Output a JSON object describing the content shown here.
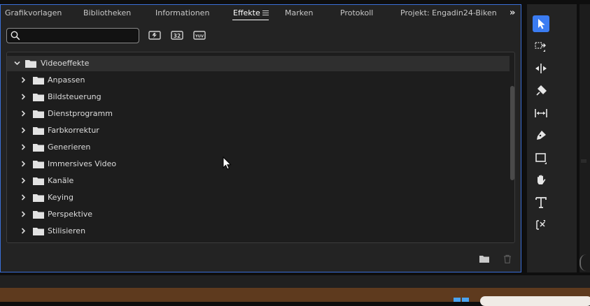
{
  "tabs": [
    {
      "label": "Grafikvorlagen"
    },
    {
      "label": "Bibliotheken"
    },
    {
      "label": "Informationen"
    },
    {
      "label": "Effekte"
    },
    {
      "label": "Marken"
    },
    {
      "label": "Protokoll"
    },
    {
      "label": "Projekt: Engadin24-Biken"
    }
  ],
  "active_tab": "Effekte",
  "search": {
    "value": "",
    "placeholder": ""
  },
  "filter_buttons": [
    {
      "icon": "accelerated-effects-icon"
    },
    {
      "icon": "32bit-effects-icon",
      "text": "32"
    },
    {
      "icon": "yuv-effects-icon",
      "text": "YUV"
    }
  ],
  "tree": {
    "root": {
      "label": "Videoeffekte",
      "expanded": true
    },
    "items": [
      {
        "label": "Anpassen"
      },
      {
        "label": "Bildsteuerung"
      },
      {
        "label": "Dienstprogramm"
      },
      {
        "label": "Farbkorrektur"
      },
      {
        "label": "Generieren"
      },
      {
        "label": "Immersives Video"
      },
      {
        "label": "Kanäle"
      },
      {
        "label": "Keying"
      },
      {
        "label": "Perspektive"
      },
      {
        "label": "Stilisieren"
      }
    ]
  },
  "tools": [
    {
      "icon": "selection-tool-icon",
      "selected": true
    },
    {
      "icon": "track-select-forward-icon"
    },
    {
      "icon": "ripple-edit-icon"
    },
    {
      "icon": "razor-icon"
    },
    {
      "icon": "slip-icon"
    },
    {
      "icon": "pen-icon"
    },
    {
      "icon": "rectangle-icon"
    },
    {
      "icon": "hand-icon"
    },
    {
      "icon": "type-icon"
    },
    {
      "icon": "remix-icon"
    }
  ],
  "colors": {
    "accent": "#3b7cf2",
    "panel": "#232323",
    "taskbar": "#5e3a1e"
  }
}
